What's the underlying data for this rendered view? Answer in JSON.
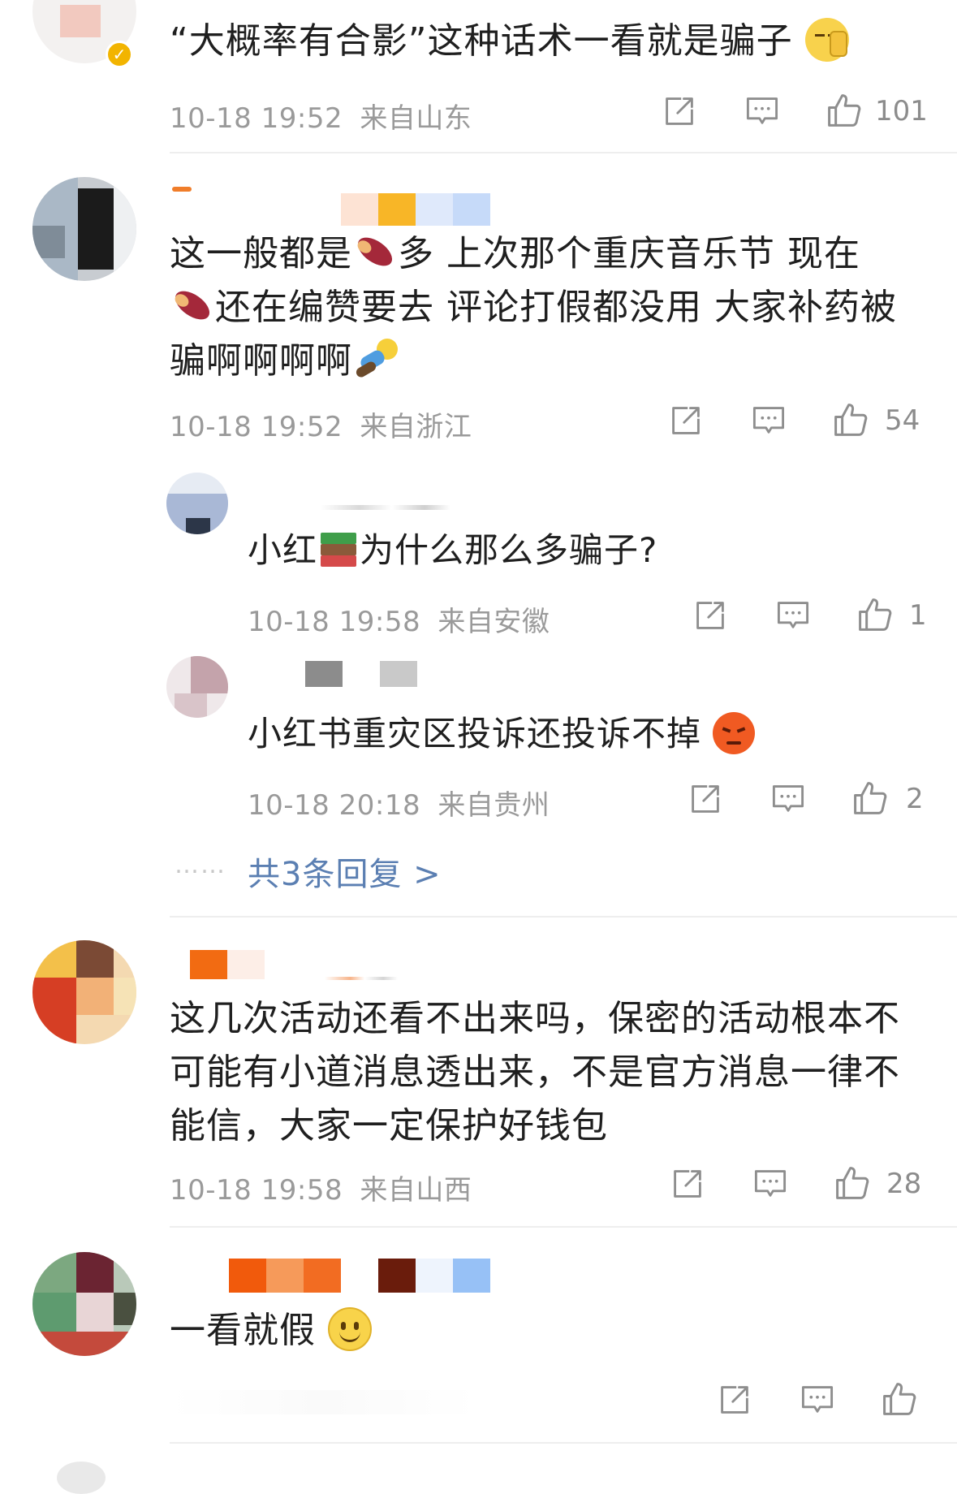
{
  "comments": [
    {
      "text": "“大概率有合影”这种话术一看就是骗子",
      "emoji": "face-with-hand-emoji",
      "time": "10-18 19:52",
      "location": "来自山东",
      "likes": "101"
    },
    {
      "text_parts": [
        "这一般都是",
        "多 上次那个重庆音乐节 现在",
        "还在编赞要去 评论打假都没用 大家补药被骗啊啊啊啊"
      ],
      "emoji": [
        "sweet-potato-emoji",
        "sweet-potato-emoji",
        "person-lying-emoji"
      ],
      "time": "10-18 19:52",
      "location": "来自浙江",
      "likes": "54",
      "replies": [
        {
          "text_parts": [
            "小红",
            "为什么那么多骗子?"
          ],
          "emoji": "books-emoji",
          "time": "10-18 19:58",
          "location": "来自安徽",
          "likes": "1"
        },
        {
          "text": "小红书重灾区投诉还投诉不掉",
          "emoji": "angry-face-emoji",
          "time": "10-18 20:18",
          "location": "来自贵州",
          "likes": "2"
        }
      ],
      "more_replies": "共3条回复 >",
      "dots": "……"
    },
    {
      "text": "这几次活动还看不出来吗，保密的活动根本不可能有小道消息透出来，不是官方消息一律不能信，大家一定保护好钱包",
      "time": "10-18 19:58",
      "location": "来自山西",
      "likes": "28"
    },
    {
      "text": "一看就假",
      "emoji": "smiling-face-emoji",
      "likes": ""
    }
  ],
  "colors": {
    "meta": "#9a9a9a",
    "link": "#5b7fb2",
    "divider": "#eeeeee",
    "verified_badge": "#f2b400"
  },
  "icons": [
    "share-icon",
    "comment-icon",
    "like-icon"
  ]
}
